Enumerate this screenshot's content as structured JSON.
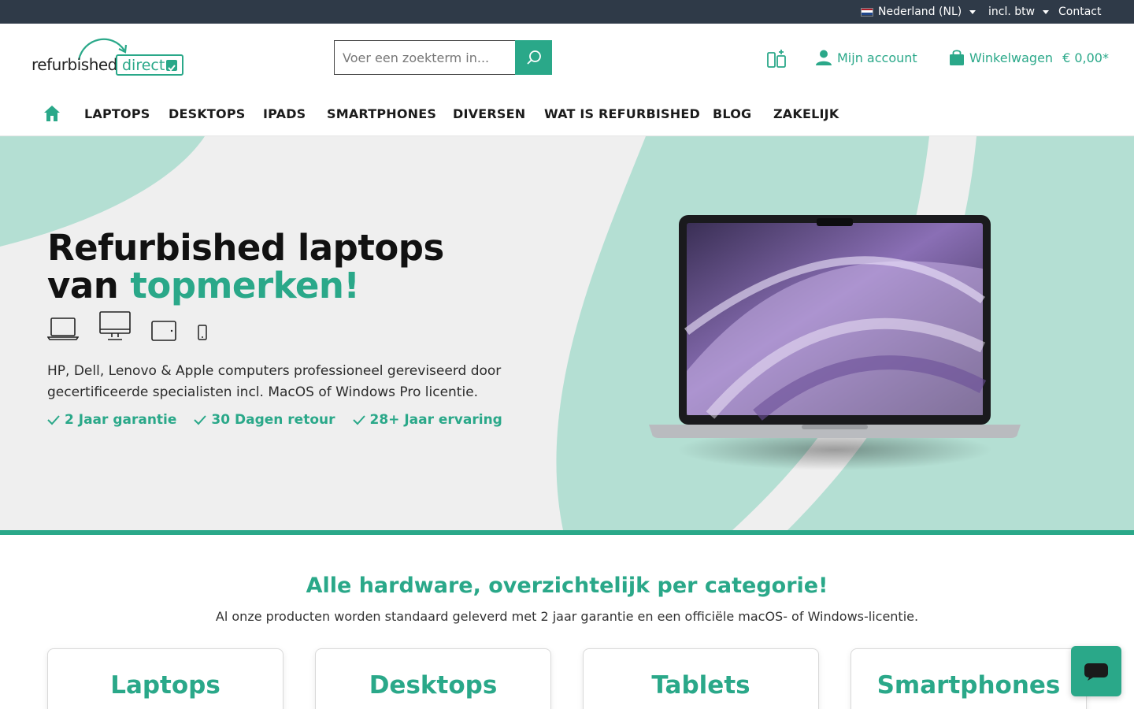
{
  "topbar": {
    "country_label": "Nederland (NL)",
    "vat_label": "incl. btw",
    "contact_label": "Contact"
  },
  "header": {
    "logo_word": "refurbished",
    "logo_box_word": "direct",
    "search_placeholder": "Voer een zoekterm in...",
    "account_label": "Mijn account",
    "cart_label": "Winkelwagen",
    "cart_total": "€ 0,00*"
  },
  "nav": {
    "items": [
      {
        "label": "LAPTOPS"
      },
      {
        "label": "DESKTOPS"
      },
      {
        "label": "IPADS"
      },
      {
        "label": "SMARTPHONES"
      },
      {
        "label": "DIVERSEN"
      },
      {
        "label": "WAT IS REFURBISHED"
      },
      {
        "label": "BLOG"
      },
      {
        "label": "ZAKELIJK"
      }
    ]
  },
  "hero": {
    "title_line1": "Refurbished laptops",
    "title_line2_prefix": "van ",
    "title_line2_accent": "topmerken!",
    "description": "HP, Dell, Lenovo & Apple computers professioneel gereviseerd door gecertificeerde specialisten incl. MacOS of Windows Pro licentie.",
    "usps": [
      "2 Jaar garantie",
      "30 Dagen retour",
      "28+ Jaar ervaring"
    ],
    "device_icons": [
      "laptop-icon",
      "desktop-icon",
      "tablet-icon",
      "smartphone-icon"
    ]
  },
  "categories": {
    "title": "Alle hardware, overzichtelijk per categorie!",
    "subtitle": "Al onze producten worden standaard geleverd met 2 jaar garantie en een officiële macOS- of Windows-licentie.",
    "cards": [
      {
        "label": "Laptops"
      },
      {
        "label": "Desktops"
      },
      {
        "label": "Tablets"
      },
      {
        "label": "Smartphones"
      }
    ]
  },
  "colors": {
    "accent": "#2aa889",
    "topbar_bg": "#2f3a48",
    "hero_bg": "#b4dfd3",
    "hero_swoosh": "#efefef"
  }
}
